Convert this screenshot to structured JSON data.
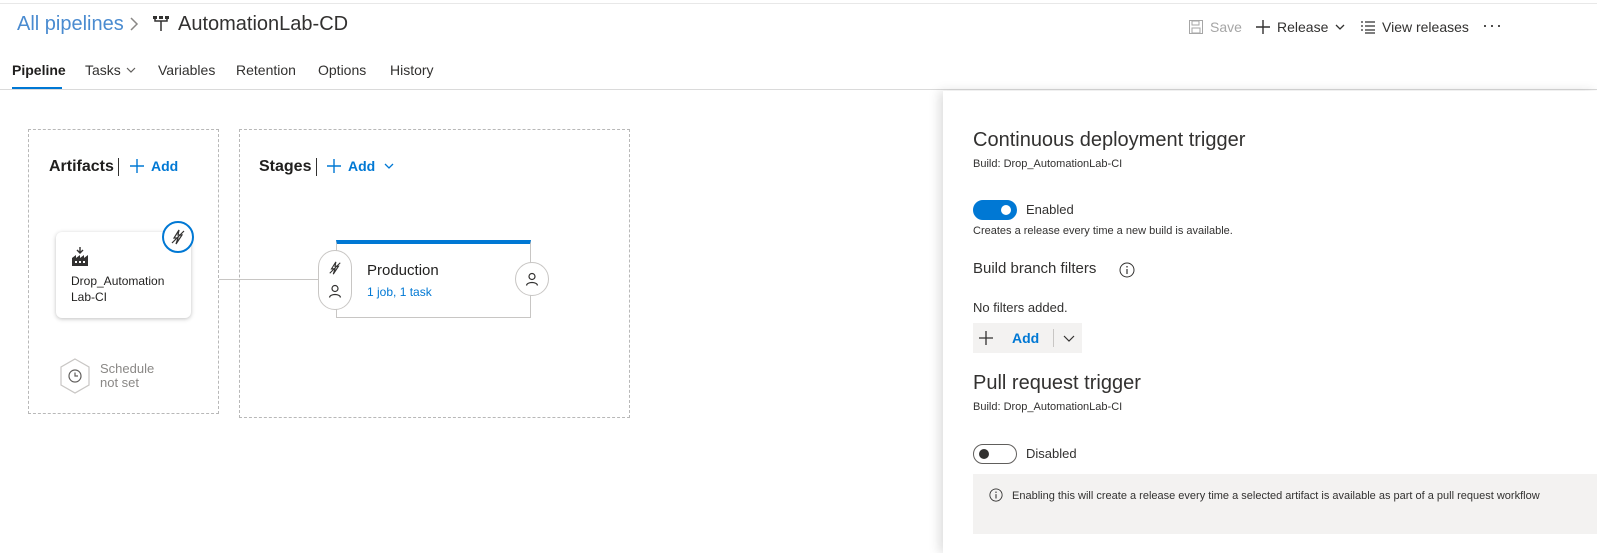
{
  "header": {
    "breadcrumb": "All pipelines",
    "pipeline_name": "AutomationLab-CD",
    "toolbar": {
      "save_label": "Save",
      "release_label": "Release",
      "view_releases_label": "View releases",
      "more_label": "···"
    }
  },
  "tabs": [
    {
      "label": "Pipeline",
      "active": true
    },
    {
      "label": "Tasks",
      "has_dropdown": true
    },
    {
      "label": "Variables"
    },
    {
      "label": "Retention"
    },
    {
      "label": "Options"
    },
    {
      "label": "History"
    }
  ],
  "artifacts": {
    "title": "Artifacts",
    "add_label": "Add",
    "items": [
      {
        "name": "Drop_Automation Lab-CI"
      }
    ],
    "schedule": "Schedule not set"
  },
  "stages": {
    "title": "Stages",
    "add_label": "Add",
    "items": [
      {
        "name": "Production",
        "summary": "1 job, 1 task"
      }
    ]
  },
  "panel": {
    "cd_trigger": {
      "title": "Continuous deployment trigger",
      "build": "Build: Drop_AutomationLab-CI",
      "toggle_label": "Enabled",
      "enabled": true,
      "description": "Creates a release every time a new build is available."
    },
    "branch_filters": {
      "title": "Build branch filters",
      "empty": "No filters added.",
      "add_label": "Add"
    },
    "pr_trigger": {
      "title": "Pull request trigger",
      "build": "Build: Drop_AutomationLab-CI",
      "toggle_label": "Disabled",
      "enabled": false,
      "info": "Enabling this will create a release every time a selected artifact is available as part of a pull request workflow"
    }
  },
  "colors": {
    "accent": "#0078d4",
    "breadcrumb": "#4a8bd0",
    "panel_info_bg": "#f3f2f1"
  }
}
